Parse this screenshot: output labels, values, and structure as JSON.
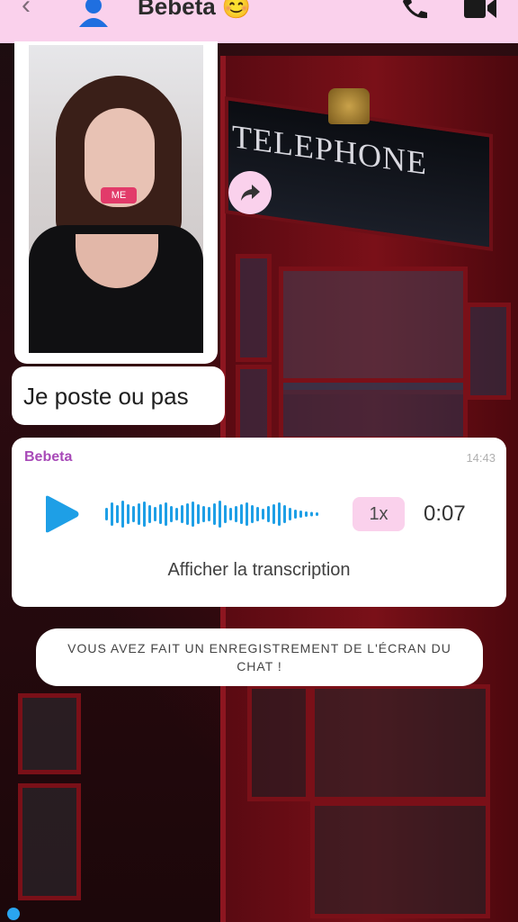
{
  "header": {
    "title": "Bebeta 😊",
    "back_icon": "chevron-left-icon",
    "avatar_icon": "user-icon",
    "call_icon": "phone-icon",
    "video_icon": "video-icon",
    "background": "#fad1ec"
  },
  "messages": {
    "photo": {
      "sticker_text": "ME"
    },
    "text": "Je poste ou pas",
    "voice": {
      "sender": "Bebeta",
      "time": "14:43",
      "speed": "1x",
      "duration": "0:07",
      "transcript_label": "Afficher la transcription",
      "accent": "#1e9fe6"
    }
  },
  "background_sign": "TELEPHONE",
  "notice": "VOUS AVEZ FAIT UN ENREGISTREMENT DE L'ÉCRAN DU CHAT !",
  "colors": {
    "pink": "#fad1ec",
    "sender": "#a84ab8",
    "play": "#1e9fe6"
  }
}
